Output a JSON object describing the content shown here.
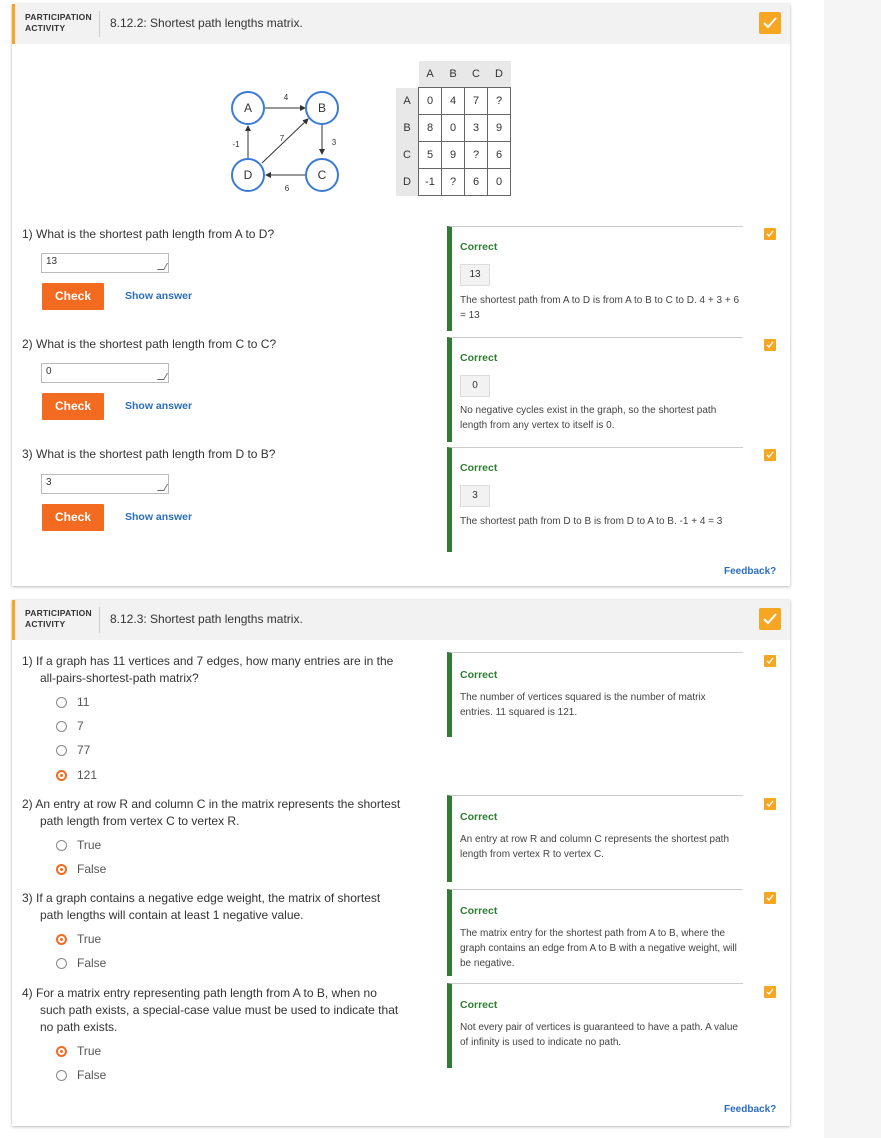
{
  "activity1": {
    "label_line1": "PARTICIPATION",
    "label_line2": "ACTIVITY",
    "title": "8.12.2: Shortest path lengths matrix.",
    "graph": {
      "nodes": [
        "A",
        "B",
        "C",
        "D"
      ],
      "weights": {
        "AB": "4",
        "DA": "-1",
        "DB": "7",
        "BC": "3",
        "CD": "6"
      }
    },
    "matrix": {
      "col_headers": [
        "A",
        "B",
        "C",
        "D"
      ],
      "row_headers": [
        "A",
        "B",
        "C",
        "D"
      ],
      "rows": [
        [
          "0",
          "4",
          "7",
          "?"
        ],
        [
          "8",
          "0",
          "3",
          "9"
        ],
        [
          "5",
          "9",
          "?",
          "6"
        ],
        [
          "-1",
          "?",
          "6",
          "0"
        ]
      ]
    },
    "questions": [
      {
        "num": "1)",
        "text": "What is the shortest path length from A to D?",
        "answer": "13",
        "check_label": "Check",
        "show_answer_label": "Show answer",
        "feedback_status": "Correct",
        "feedback_value": "13",
        "feedback_text": "The shortest path from A to D is from A to B to C to D. 4 + 3 + 6 = 13"
      },
      {
        "num": "2)",
        "text": "What is the shortest path length from C to C?",
        "answer": "0",
        "check_label": "Check",
        "show_answer_label": "Show answer",
        "feedback_status": "Correct",
        "feedback_value": "0",
        "feedback_text": "No negative cycles exist in the graph, so the shortest path length from any vertex to itself is 0."
      },
      {
        "num": "3)",
        "text": "What is the shortest path length from D to B?",
        "answer": "3",
        "check_label": "Check",
        "show_answer_label": "Show answer",
        "feedback_status": "Correct",
        "feedback_value": "3",
        "feedback_text": "The shortest path from D to B is from D to A to B. -1 + 4 = 3"
      }
    ],
    "feedback_link": "Feedback?"
  },
  "activity2": {
    "label_line1": "PARTICIPATION",
    "label_line2": "ACTIVITY",
    "title": "8.12.3: Shortest path lengths matrix.",
    "questions": [
      {
        "num": "1)",
        "text_line1": "If a graph has 11 vertices and 7 edges, how many entries are in the",
        "text_line2": "all-pairs-shortest-path matrix?",
        "text_line3": "",
        "options": [
          {
            "label": "11",
            "selected": false
          },
          {
            "label": "7",
            "selected": false
          },
          {
            "label": "77",
            "selected": false
          },
          {
            "label": "121",
            "selected": true
          }
        ],
        "feedback_status": "Correct",
        "feedback_text": "The number of vertices squared is the number of matrix entries. 11 squared is 121."
      },
      {
        "num": "2)",
        "text_line1": "An entry at row R and column C in the matrix represents the shortest",
        "text_line2": "path length from vertex C to vertex R.",
        "text_line3": "",
        "options": [
          {
            "label": "True",
            "selected": false
          },
          {
            "label": "False",
            "selected": true
          }
        ],
        "feedback_status": "Correct",
        "feedback_text": "An entry at row R and column C represents the shortest path length from vertex R to vertex C."
      },
      {
        "num": "3)",
        "text_line1": "If a graph contains a negative edge weight, the matrix of shortest",
        "text_line2": "path lengths will contain at least 1 negative value.",
        "text_line3": "",
        "options": [
          {
            "label": "True",
            "selected": true
          },
          {
            "label": "False",
            "selected": false
          }
        ],
        "feedback_status": "Correct",
        "feedback_text": "The matrix entry for the shortest path from A to B, where the graph contains an edge from A to B with a negative weight, will be negative."
      },
      {
        "num": "4)",
        "text_line1": "For a matrix entry representing path length from A to B, when no",
        "text_line2": "such path exists, a special-case value must be used to indicate that",
        "text_line3": "no path exists.",
        "options": [
          {
            "label": "True",
            "selected": true
          },
          {
            "label": "False",
            "selected": false
          }
        ],
        "feedback_status": "Correct",
        "feedback_text": "Not every pair of vertices is guaranteed to have a path. A value of infinity is used to indicate no path."
      }
    ],
    "feedback_link": "Feedback?"
  },
  "colors": {
    "accent_orange": "#f26b21",
    "complete_badge": "#f5a623",
    "correct_green": "#2e7d32",
    "link_blue": "#2a6ebb",
    "node_blue": "#3b7bd6"
  }
}
